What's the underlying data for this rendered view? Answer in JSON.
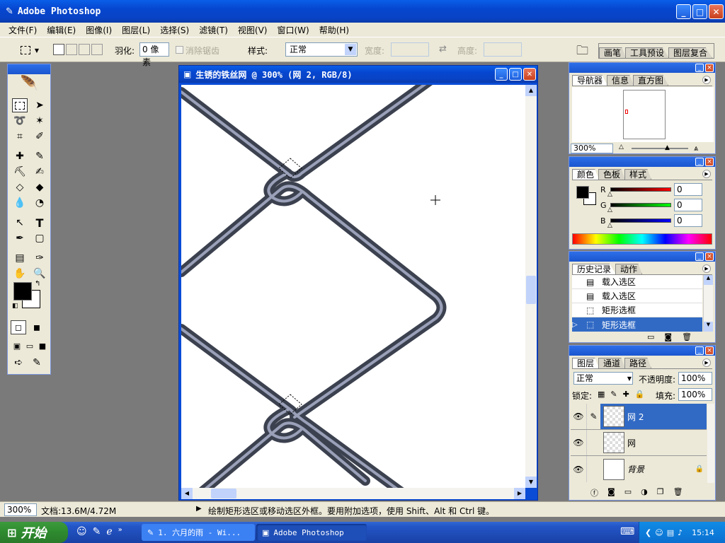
{
  "app": {
    "title": "Adobe Photoshop"
  },
  "menu": [
    "文件(F)",
    "编辑(E)",
    "图像(I)",
    "图层(L)",
    "选择(S)",
    "滤镜(T)",
    "视图(V)",
    "窗口(W)",
    "帮助(H)"
  ],
  "options": {
    "feather_label": "羽化:",
    "feather_value": "0 像素",
    "antialias_label": "消除锯齿",
    "style_label": "样式:",
    "style_value": "正常",
    "width_label": "宽度:",
    "height_label": "高度:",
    "palette_tabs": [
      "画笔",
      "工具预设",
      "图层复合"
    ]
  },
  "document": {
    "title": "生锈的铁丝网 @ 300% (网 2, RGB/8)"
  },
  "navigator": {
    "tabs": [
      "导航器",
      "信息",
      "直方图"
    ],
    "zoom": "300%"
  },
  "color": {
    "tabs": [
      "颜色",
      "色板",
      "样式"
    ],
    "r_label": "R",
    "g_label": "G",
    "b_label": "B",
    "r": "0",
    "g": "0",
    "b": "0"
  },
  "history": {
    "tabs": [
      "历史记录",
      "动作"
    ],
    "items": [
      "载入选区",
      "载入选区",
      "矩形选框",
      "矩形选框"
    ],
    "selected_index": 3
  },
  "layers": {
    "tabs": [
      "图层",
      "通道",
      "路径"
    ],
    "blend": "正常",
    "opacity_label": "不透明度:",
    "opacity": "100%",
    "lock_label": "锁定:",
    "fill_label": "填充:",
    "fill": "100%",
    "items": [
      {
        "name": "网 2",
        "selected": true
      },
      {
        "name": "网",
        "selected": false
      },
      {
        "name": "背景",
        "selected": false
      }
    ]
  },
  "status": {
    "zoom": "300%",
    "doc": "文档:13.6M/4.72M",
    "hint": "绘制矩形选区或移动选区外框。要用附加选项，使用 Shift、Alt 和 Ctrl 键。"
  },
  "taskbar": {
    "start": "开始",
    "tasks": [
      "1. 六月的雨 - Wi...",
      "Adobe Photoshop"
    ],
    "clock": "15:14"
  }
}
